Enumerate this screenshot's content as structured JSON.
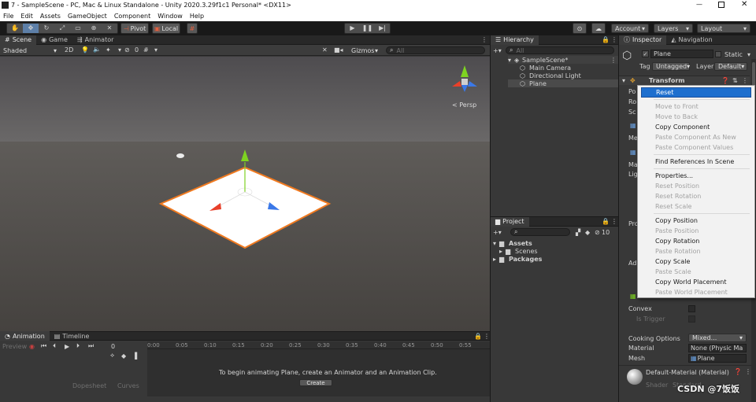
{
  "window_title": "7 - SampleScene - PC, Mac & Linux Standalone - Unity 2020.3.29f1c1 Personal* <DX11>",
  "menu": [
    "File",
    "Edit",
    "Assets",
    "GameObject",
    "Component",
    "Window",
    "Help"
  ],
  "toolbar": {
    "pivot": "Pivot",
    "local": "Local",
    "account": "Account",
    "layers": "Layers",
    "layout": "Layout"
  },
  "scene": {
    "tabs": [
      "Scene",
      "Game",
      "Animator"
    ],
    "shading": "Shaded",
    "mode_2d": "2D",
    "fx_count": "0",
    "gizmos": "Gizmos",
    "search_placeholder": "All",
    "persp": "< Persp"
  },
  "hierarchy": {
    "tab": "Hierarchy",
    "search_placeholder": "All",
    "scene": "SampleScene*",
    "items": [
      "Main Camera",
      "Directional Light",
      "Plane"
    ]
  },
  "project": {
    "tab": "Project",
    "count": "10",
    "items": [
      "Assets",
      "Scenes",
      "Packages"
    ]
  },
  "animation": {
    "tabs": [
      "Animation",
      "Timeline"
    ],
    "preview": "Preview",
    "frame": "0",
    "ticks": [
      "0:00",
      "0:05",
      "0:10",
      "0:15",
      "0:20",
      "0:25",
      "0:30",
      "0:35",
      "0:40",
      "0:45",
      "0:50",
      "0:55"
    ],
    "message": "To begin animating Plane, create an Animator and an Animation Clip.",
    "create": "Create",
    "dopesheet": "Dopesheet",
    "curves": "Curves"
  },
  "inspector": {
    "tabs": [
      "Inspector",
      "Navigation"
    ],
    "object_name": "Plane",
    "static": "Static",
    "tag_label": "Tag",
    "tag": "Untagged",
    "layer_label": "Layer",
    "layer": "Default",
    "transform": "Transform",
    "left_labels": [
      "Po",
      "Ro",
      "Sc",
      "Me",
      "Ma",
      "Lig",
      "Pro",
      "Ad"
    ],
    "convex": "Convex",
    "is_trigger": "Is Trigger",
    "cooking_label": "Cooking Options",
    "cooking": "Mixed...",
    "material_label": "Material",
    "material": "None (Physic Ma",
    "mesh_label": "Mesh",
    "mesh": "Plane",
    "material_name": "Default-Material (Material)",
    "shader": "Shader",
    "shader_value": "Standard"
  },
  "context_menu": [
    {
      "label": "Reset",
      "state": "highlight"
    },
    {
      "sep": true
    },
    {
      "label": "Move to Front",
      "state": "disabled"
    },
    {
      "label": "Move to Back",
      "state": "disabled"
    },
    {
      "label": "Copy Component",
      "state": "enabled"
    },
    {
      "label": "Paste Component As New",
      "state": "disabled"
    },
    {
      "label": "Paste Component Values",
      "state": "disabled"
    },
    {
      "sep": true
    },
    {
      "label": "Find References In Scene",
      "state": "enabled"
    },
    {
      "sep": true
    },
    {
      "label": "Properties...",
      "state": "enabled"
    },
    {
      "label": "Reset Position",
      "state": "disabled"
    },
    {
      "label": "Reset Rotation",
      "state": "disabled"
    },
    {
      "label": "Reset Scale",
      "state": "disabled"
    },
    {
      "sep": true
    },
    {
      "label": "Copy Position",
      "state": "enabled"
    },
    {
      "label": "Paste Position",
      "state": "disabled"
    },
    {
      "label": "Copy Rotation",
      "state": "enabled"
    },
    {
      "label": "Paste Rotation",
      "state": "disabled"
    },
    {
      "label": "Copy Scale",
      "state": "enabled"
    },
    {
      "label": "Paste Scale",
      "state": "disabled"
    },
    {
      "label": "Copy World Placement",
      "state": "enabled"
    },
    {
      "label": "Paste World Placement",
      "state": "disabled"
    }
  ],
  "watermark": "CSDN @7饭饭",
  "colors": {
    "accent": "#3a72b0",
    "highlight": "#1e6fce",
    "selected_outline": "#f07a20",
    "scene_sky": "#5b5a5d",
    "scene_ground": "#4a4846"
  }
}
